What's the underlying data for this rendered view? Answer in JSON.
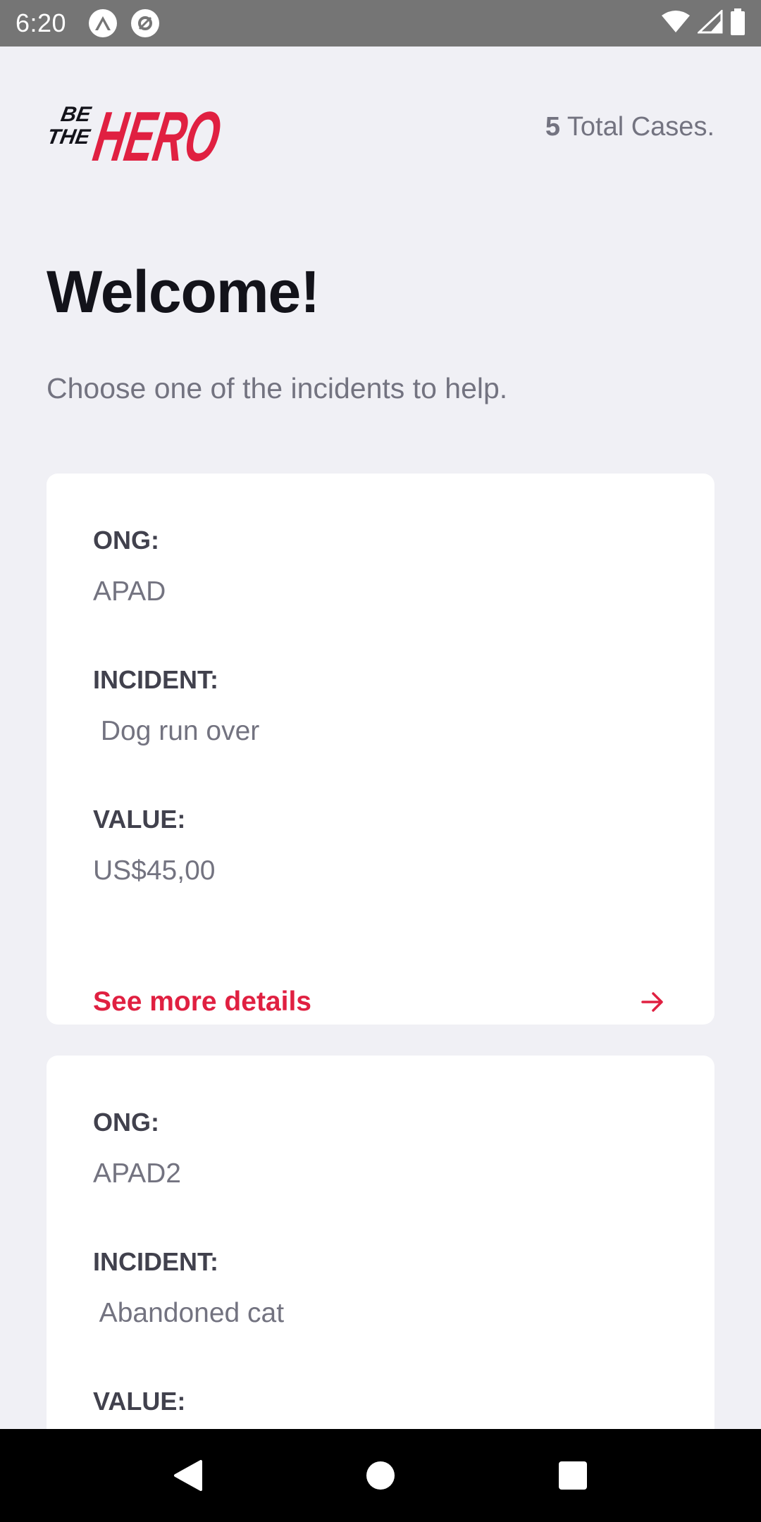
{
  "status_bar": {
    "time": "6:20"
  },
  "header": {
    "logo_text_small_1": "BE",
    "logo_text_small_2": "THE",
    "logo_text_big": "HERO",
    "total_count": "5",
    "total_label": " Total Cases."
  },
  "main": {
    "title": "Welcome!",
    "description": "Choose one of the incidents to help."
  },
  "labels": {
    "ong": "ONG:",
    "incident": "INCIDENT:",
    "value": "VALUE:",
    "details": "See more details"
  },
  "incidents": [
    {
      "ong": "APAD",
      "incident": " Dog run over",
      "value": "US$45,00"
    },
    {
      "ong": "APAD2",
      "incident": " Abandoned cat"
    }
  ],
  "colors": {
    "brand": "#e02041",
    "background": "#f0f0f5",
    "title": "#13131a",
    "label": "#41414d",
    "muted": "#737380"
  },
  "icons": {
    "details": "arrow-right-icon",
    "nav_back": "back-triangle-icon",
    "nav_home": "home-circle-icon",
    "nav_recents": "recents-square-icon"
  }
}
